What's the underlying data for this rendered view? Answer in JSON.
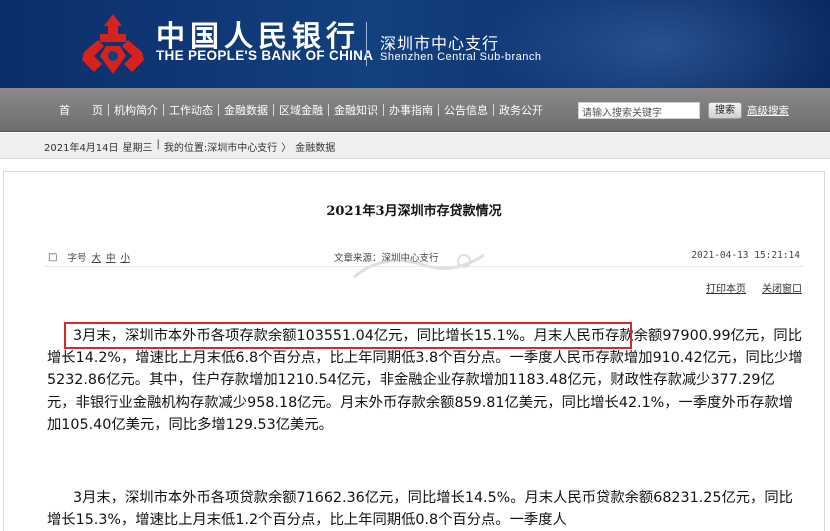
{
  "header": {
    "bank_name_cn": "中国人民银行",
    "bank_name_en": "THE PEOPLE'S BANK OF CHINA",
    "branch_cn": "深圳市中心支行",
    "branch_en": "Shenzhen  Central  Sub-branch"
  },
  "nav": {
    "items": [
      "首　　页",
      "机构简介",
      "工作动态",
      "金融数据",
      "区域金融",
      "金融知识",
      "办事指南",
      "公告信息",
      "政务公开"
    ],
    "search_placeholder": "请输入搜索关键字",
    "search_button": "搜索",
    "advanced_search": "高级搜索"
  },
  "breadcrumb": {
    "date": "2021年4月14日",
    "weekday": "星期三",
    "sep": "|",
    "location_label": "我的位置:",
    "path1": "深圳市中心支行",
    "arrow": "〉",
    "path2": "金融数据"
  },
  "article": {
    "title": "2021年3月深圳市存贷款情况",
    "font_box": "□",
    "font_label": "字号",
    "font_large": "大",
    "font_medium": "中",
    "font_small": "小",
    "source": "文章来源：深圳中心支行",
    "datetime": "2021-04-13 15:21:14",
    "print": "打印本页",
    "close": "关闭窗口",
    "para1_highlight": "3月末，深圳市本外币各项存款余额103551.04亿元，同比增长15.1%。",
    "para1_rest": "月末人民币存款余额97900.99亿元，同比增长14.2%，增速比上月末低6.8个百分点，比上年同期低3.8个百分点。一季度人民币存款增加910.42亿元，同比少增5232.86亿元。其中，住户存款增加1210.54亿元，非金融企业存款增加1183.48亿元，财政性存款减少377.29亿元，非银行业金融机构存款减少958.18亿元。月末外币存款余额859.81亿美元，同比增长42.1%，一季度外币存款增加105.40亿美元，同比多增129.53亿美元。",
    "para2": "3月末，深圳市本外币各项贷款余额71662.36亿元，同比增长14.5%。月末人民币贷款余额68231.25亿元，同比增长15.3%，增速比上月末低1.2个百分点，比上年同期低0.8个百分点。一季度人"
  },
  "colors": {
    "banner": "#13407f",
    "nav": "#7a7a7a",
    "highlight_border": "#d42a2a"
  }
}
